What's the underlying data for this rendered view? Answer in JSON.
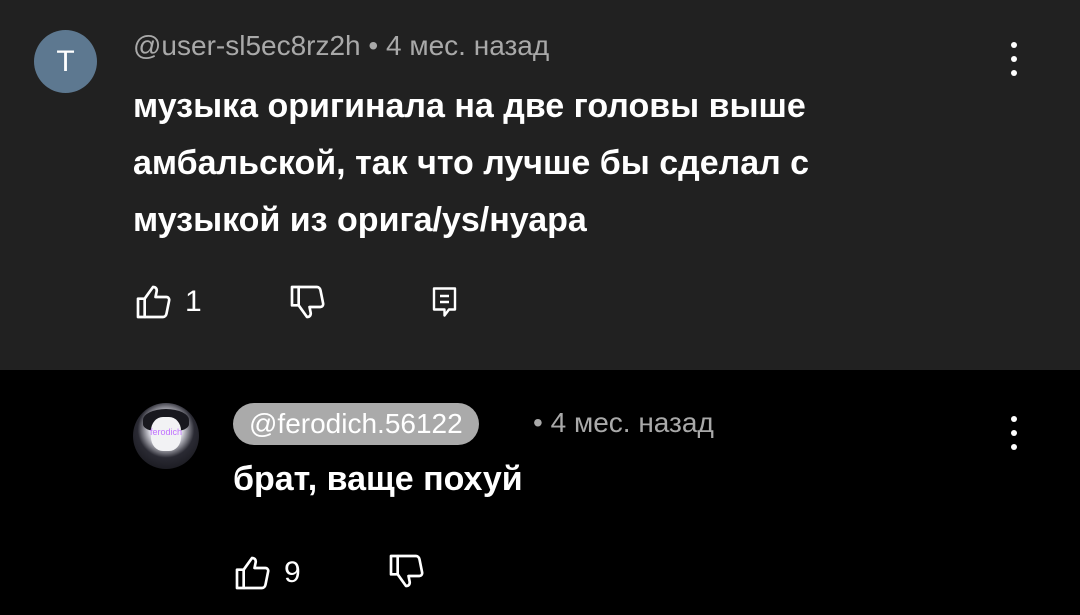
{
  "comments": [
    {
      "avatar_letter": "T",
      "author": "@user-sl5ec8rz2h",
      "separator": "•",
      "time": "4 мес. назад",
      "text": "музыка оригинала на две головы выше амбальской, так что лучше бы сделал с музыкой из орига/ys/нуара",
      "likes": "1",
      "icons": {
        "like": "thumbs-up-icon",
        "dislike": "thumbs-down-icon",
        "reply": "reply-icon",
        "more": "more-vertical-icon"
      }
    },
    {
      "avatar_text": "ferodich",
      "author": "@ferodich.56122",
      "separator": "•",
      "time": "4 мес. назад",
      "text": "брат, ваще похуй",
      "likes": "9",
      "icons": {
        "like": "thumbs-up-icon",
        "dislike": "thumbs-down-icon",
        "more": "more-vertical-icon"
      }
    }
  ]
}
